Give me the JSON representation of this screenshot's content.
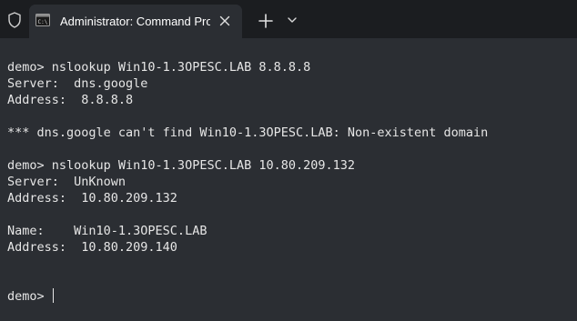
{
  "window": {
    "admin_shield_icon": "shield-icon",
    "tab": {
      "icon": "command-prompt-icon",
      "title": "Administrator: Command Prompt",
      "close_icon": "close-icon"
    },
    "new_tab_icon": "plus-icon",
    "dropdown_icon": "chevron-down-icon"
  },
  "terminal": {
    "lines": [
      "demo> nslookup Win10-1.3OPESC.LAB 8.8.8.8",
      "Server:  dns.google",
      "Address:  8.8.8.8",
      "",
      "*** dns.google can't find Win10-1.3OPESC.LAB: Non-existent domain",
      "",
      "demo> nslookup Win10-1.3OPESC.LAB 10.80.209.132",
      "Server:  UnKnown",
      "Address:  10.80.209.132",
      "",
      "Name:    Win10-1.3OPESC.LAB",
      "Address:  10.80.209.140",
      "",
      "",
      "demo> "
    ]
  },
  "colors": {
    "tabbar_bg": "#1b1d20",
    "terminal_bg": "#2b2e33",
    "text": "#e6e6e6"
  }
}
